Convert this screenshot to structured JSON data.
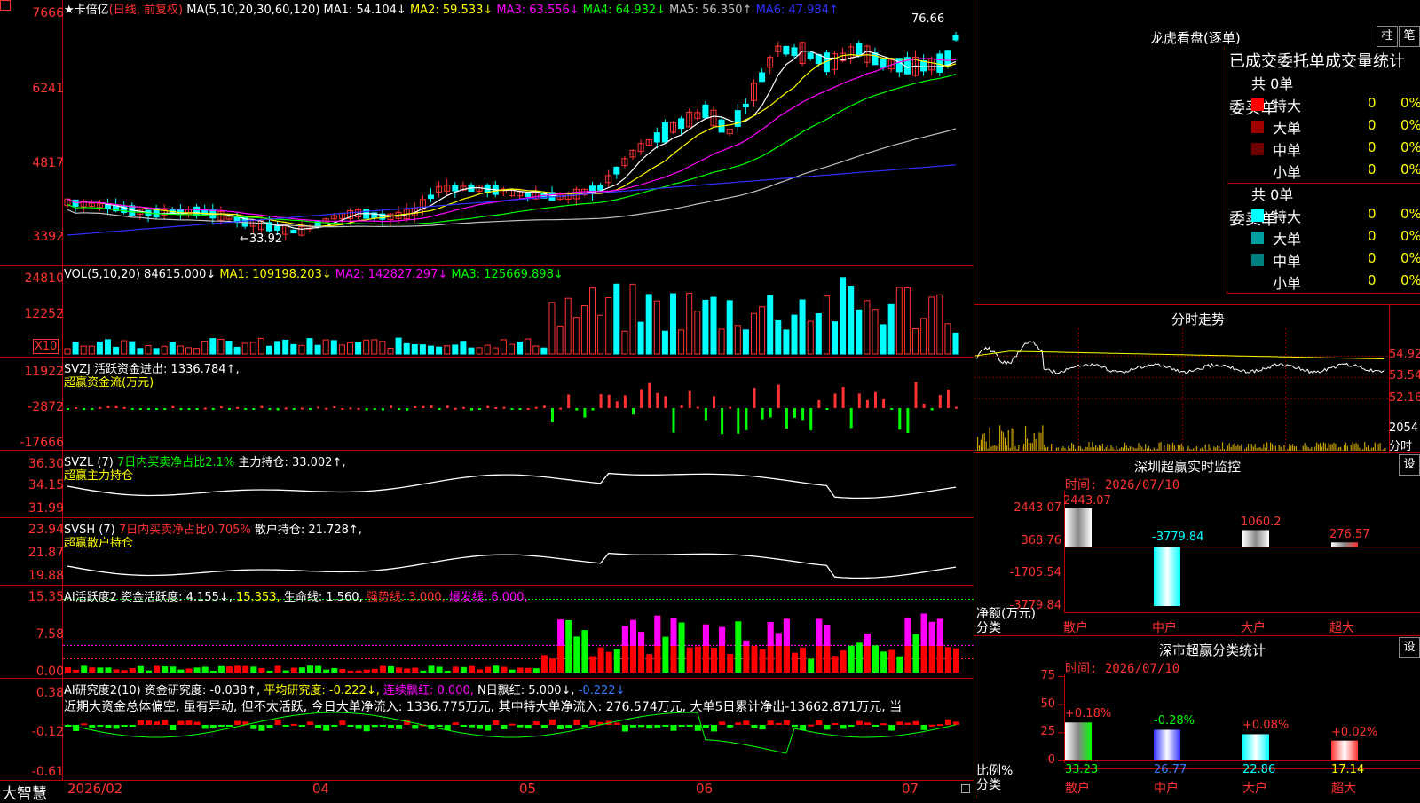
{
  "header": {
    "star": "★",
    "stock_name": "卡倍亿",
    "period": "(日线, 前复权)",
    "ma_label": "MA(5,10,20,30,60,120)",
    "ma_values": [
      {
        "text": "MA1: 54.104↓",
        "color": "#ffffff"
      },
      {
        "text": "MA2: 59.533↓",
        "color": "#ffff00"
      },
      {
        "text": "MA3: 63.556↓",
        "color": "#ff00ff"
      },
      {
        "text": "MA4: 64.932↓",
        "color": "#00ff00"
      },
      {
        "text": "MA5: 56.350↑",
        "color": "#c0c0c0"
      },
      {
        "text": "MA6: 47.984↑",
        "color": "#3030ff"
      }
    ]
  },
  "main_chart": {
    "y_ticks": [
      "7666",
      "6241",
      "4817",
      "3392"
    ],
    "high_label": "76.66",
    "low_label": "←33.92"
  },
  "vol_panel": {
    "title": "VOL(5,10,20)",
    "value": "84615.000↓",
    "items": [
      {
        "text": "MA1: 109198.203↓",
        "color": "#ffff00"
      },
      {
        "text": "MA2: 142827.297↓",
        "color": "#ff00ff"
      },
      {
        "text": "MA3: 125669.898↓",
        "color": "#00ff00"
      }
    ],
    "y_ticks": [
      "24810",
      "12252"
    ],
    "unit": "X10"
  },
  "svzj_panel": {
    "title": "SVZJ",
    "text": "活跃资金进出: 1336.784↑,",
    "subtitle": "超赢资金流(万元)",
    "y_ticks": [
      "11922",
      "-2872",
      "-17666"
    ]
  },
  "svzl_panel": {
    "title": "SVZL (7)",
    "text1": "7日内买卖净占比2.1%",
    "text2": "主力持仓: 33.002↑,",
    "subtitle": "超赢主力持仓",
    "y_ticks": [
      "36.30",
      "34.15",
      "31.99"
    ]
  },
  "svsh_panel": {
    "title": "SVSH (7)",
    "text1": "7日内买卖净占比0.705%",
    "text2": "散户持仓: 21.728↑,",
    "subtitle": "超赢散户持仓",
    "y_ticks": [
      "23.94",
      "21.87",
      "19.88"
    ]
  },
  "ai_active_panel": {
    "title": "AI活跃度2",
    "text1": "资金活跃度: 4.155↓,",
    "text2": "15.353,",
    "text3": "生命线: 1.560,",
    "text4": "强势线: 3.000,",
    "text5": "爆发线: 6.000,",
    "y_ticks": [
      "15.35",
      "7.58",
      "0.00"
    ]
  },
  "ai_research_panel": {
    "title": "AI研究度2(10)",
    "text1": "资金研究度: -0.038↑,",
    "text2": "平均研究度: -0.222↓,",
    "text3": "连续飘红: 0.000,",
    "text4": "N日飘红: 5.000↓,",
    "text5": "-0.222↓",
    "description": "近期大资金总体偏空, 虽有异动, 但不太活跃, 今日大单净流入: 1336.775万元, 其中特大单净流入: 276.574万元, 大单5日累计净出-13662.871万元, 当",
    "y_ticks": [
      "0.38",
      "-0.12",
      "-0.61"
    ]
  },
  "x_axis": {
    "brand": "大智慧",
    "labels": [
      "2026/02",
      "04",
      "05",
      "06",
      "07"
    ]
  },
  "dragon_tiger": {
    "title": "龙虎看盘(逐单)",
    "btn_bar": "柱",
    "btn_pen": "笔",
    "subtitle": "已成交委托单成交量统计",
    "buy": {
      "label": "委买单",
      "total": "共 0单",
      "rows": [
        {
          "name": "特大",
          "count": "0",
          "pct": "0%",
          "color": "#ff0000"
        },
        {
          "name": "大单",
          "count": "0",
          "pct": "0%",
          "color": "#a00000"
        },
        {
          "name": "中单",
          "count": "0",
          "pct": "0%",
          "color": "#700000"
        },
        {
          "name": "小单",
          "count": "0",
          "pct": "0%",
          "color": ""
        }
      ]
    },
    "sell": {
      "label": "委卖单",
      "total": "共 0单",
      "rows": [
        {
          "name": "特大",
          "count": "0",
          "pct": "0%",
          "color": "#00ffff"
        },
        {
          "name": "大单",
          "count": "0",
          "pct": "0%",
          "color": "#00a0a0"
        },
        {
          "name": "中单",
          "count": "0",
          "pct": "0%",
          "color": "#008080"
        },
        {
          "name": "小单",
          "count": "0",
          "pct": "0%",
          "color": ""
        }
      ]
    }
  },
  "intraday": {
    "title": "分时走势",
    "y_ticks": [
      "54.92",
      "53.54",
      "52.16"
    ],
    "vol_tick": "2054",
    "vol_label": "分时"
  },
  "sz_monitor": {
    "title": "深圳超赢实时监控",
    "btn": "设",
    "time": "时间: 2026/07/10",
    "y_ticks": [
      "2443.07",
      "368.76",
      "-1705.54",
      "-3779.84"
    ],
    "unit_label": "净额(万元)",
    "class_label": "分类",
    "chart_data": {
      "type": "bar",
      "categories": [
        "散户",
        "中户",
        "大户",
        "超大"
      ],
      "values": [
        2443.07,
        -3779.84,
        1060.2,
        276.57
      ],
      "value_labels": [
        "2443.07",
        "-3779.84",
        "1060.2",
        "276.57"
      ],
      "ylim": [
        -3779.84,
        2443.07
      ]
    }
  },
  "sz_stats": {
    "title": "深市超赢分类统计",
    "btn": "设",
    "time": "时间: 2026/07/10",
    "y_ticks": [
      "75",
      "50",
      "25",
      "0"
    ],
    "ratio_label": "比例%",
    "class_label": "分类",
    "chart_data": {
      "type": "bar",
      "categories": [
        "散户",
        "中户",
        "大户",
        "超大"
      ],
      "values": [
        33.23,
        26.77,
        22.86,
        17.14
      ],
      "changes": [
        "+0.18%",
        "-0.28%",
        "+0.08%",
        "+0.02%"
      ],
      "ylim": [
        0,
        75
      ]
    }
  }
}
